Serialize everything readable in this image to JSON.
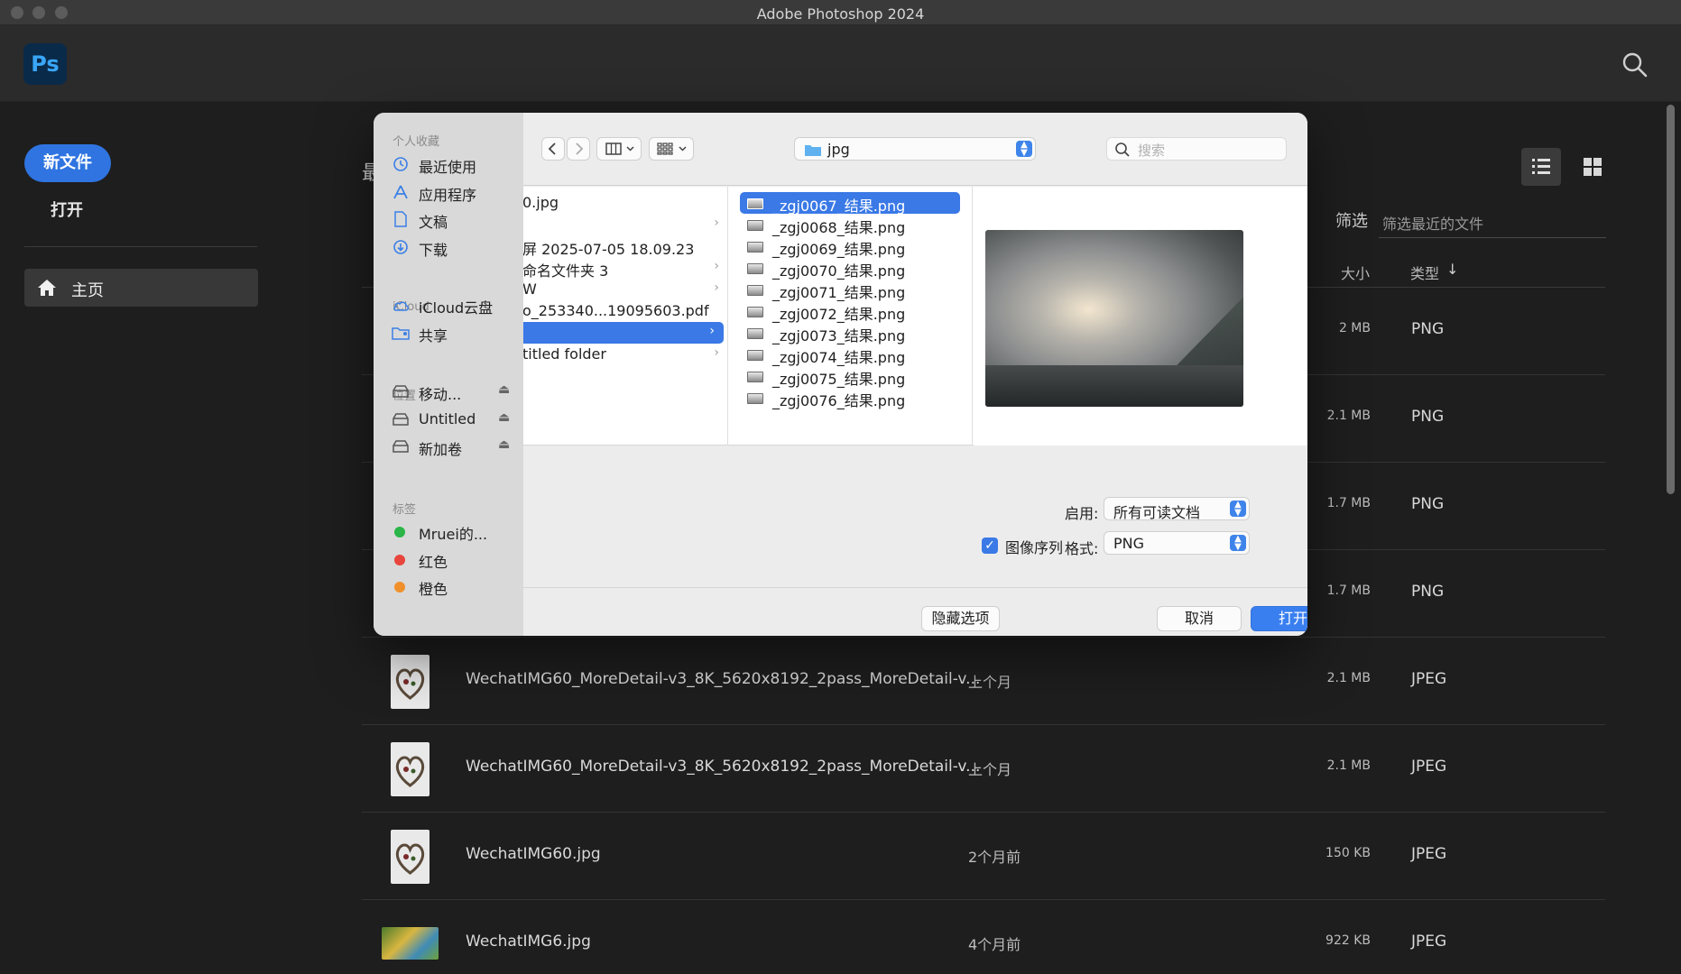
{
  "window": {
    "title": "Adobe Photoshop 2024"
  },
  "app": {
    "logo": "Ps"
  },
  "nav": {
    "new_file": "新文件",
    "open": "打开",
    "home": "主页"
  },
  "main": {
    "title_fragment": "最",
    "filter_label": "筛选",
    "filter_placeholder": "筛选最近的文件",
    "col_size": "大小",
    "col_type": "类型",
    "rows": [
      {
        "name": "",
        "date": "",
        "size": "2 MB",
        "type": "PNG",
        "thumb": "none"
      },
      {
        "name": "",
        "date": "",
        "size": "2.1 MB",
        "type": "PNG",
        "thumb": "none"
      },
      {
        "name": "",
        "date": "",
        "size": "1.7 MB",
        "type": "PNG",
        "thumb": "none"
      },
      {
        "name": "",
        "date": "",
        "size": "1.7 MB",
        "type": "PNG",
        "thumb": "none"
      },
      {
        "name": "WechatIMG60_MoreDetail-v3_8K_5620x8192_2pass_MoreDetail-v...",
        "date": "上个月",
        "size": "2.1 MB",
        "type": "JPEG",
        "thumb": "heart"
      },
      {
        "name": "WechatIMG60_MoreDetail-v3_8K_5620x8192_2pass_MoreDetail-v...",
        "date": "上个月",
        "size": "2.1 MB",
        "type": "JPEG",
        "thumb": "heart"
      },
      {
        "name": "WechatIMG60.jpg",
        "date": "2个月前",
        "size": "150 KB",
        "type": "JPEG",
        "thumb": "heart"
      },
      {
        "name": "WechatIMG6.jpg",
        "date": "4个月前",
        "size": "922 KB",
        "type": "JPEG",
        "thumb": "landscape"
      }
    ]
  },
  "dialog": {
    "sidebar": {
      "favorites_heading": "个人收藏",
      "favorites": [
        {
          "label": "最近使用",
          "icon": "clock-icon"
        },
        {
          "label": "应用程序",
          "icon": "apps-icon"
        },
        {
          "label": "文稿",
          "icon": "document-icon"
        },
        {
          "label": "下载",
          "icon": "download-icon"
        }
      ],
      "icloud_heading": "iCloud",
      "icloud": [
        {
          "label": "iCloud云盘",
          "icon": "cloud-icon"
        },
        {
          "label": "共享",
          "icon": "shared-folder-icon"
        }
      ],
      "locations_heading": "位置",
      "locations": [
        {
          "label": "移动...",
          "icon": "drive-icon"
        },
        {
          "label": "Untitled",
          "icon": "drive-icon"
        },
        {
          "label": "新加卷",
          "icon": "drive-icon"
        }
      ],
      "tags_heading": "标签",
      "tags": [
        {
          "label": "Mruei的...",
          "color": "#2bb548"
        },
        {
          "label": "红色",
          "color": "#e8453c"
        },
        {
          "label": "橙色",
          "color": "#f0902a"
        }
      ]
    },
    "path": "jpg",
    "search_placeholder": "搜索",
    "col1": [
      {
        "label": "0.jpg",
        "chevron": false
      },
      {
        "label": "",
        "chevron": true
      },
      {
        "label": "屏 2025-07-05 18.09.23",
        "chevron": false
      },
      {
        "label": "命名文件夹 3",
        "chevron": true
      },
      {
        "label": "W",
        "chevron": true
      },
      {
        "label": "o_253340...19095603.pdf",
        "chevron": false
      },
      {
        "label": "",
        "chevron": true,
        "selected": true
      },
      {
        "label": "titled folder",
        "chevron": true
      }
    ],
    "col2": [
      "_zgj0067_结果.png",
      "_zgj0068_结果.png",
      "_zgj0069_结果.png",
      "_zgj0070_结果.png",
      "_zgj0071_结果.png",
      "_zgj0072_结果.png",
      "_zgj0073_结果.png",
      "_zgj0074_结果.png",
      "_zgj0075_结果.png",
      "_zgj0076_结果.png"
    ],
    "enable_label": "启用:",
    "enable_value": "所有可读文档",
    "format_label": "格式:",
    "format_value": "PNG",
    "image_sequence_label": "图像序列",
    "image_sequence_checked": true,
    "hide_options": "隐藏选项",
    "cancel": "取消",
    "open": "打开"
  }
}
